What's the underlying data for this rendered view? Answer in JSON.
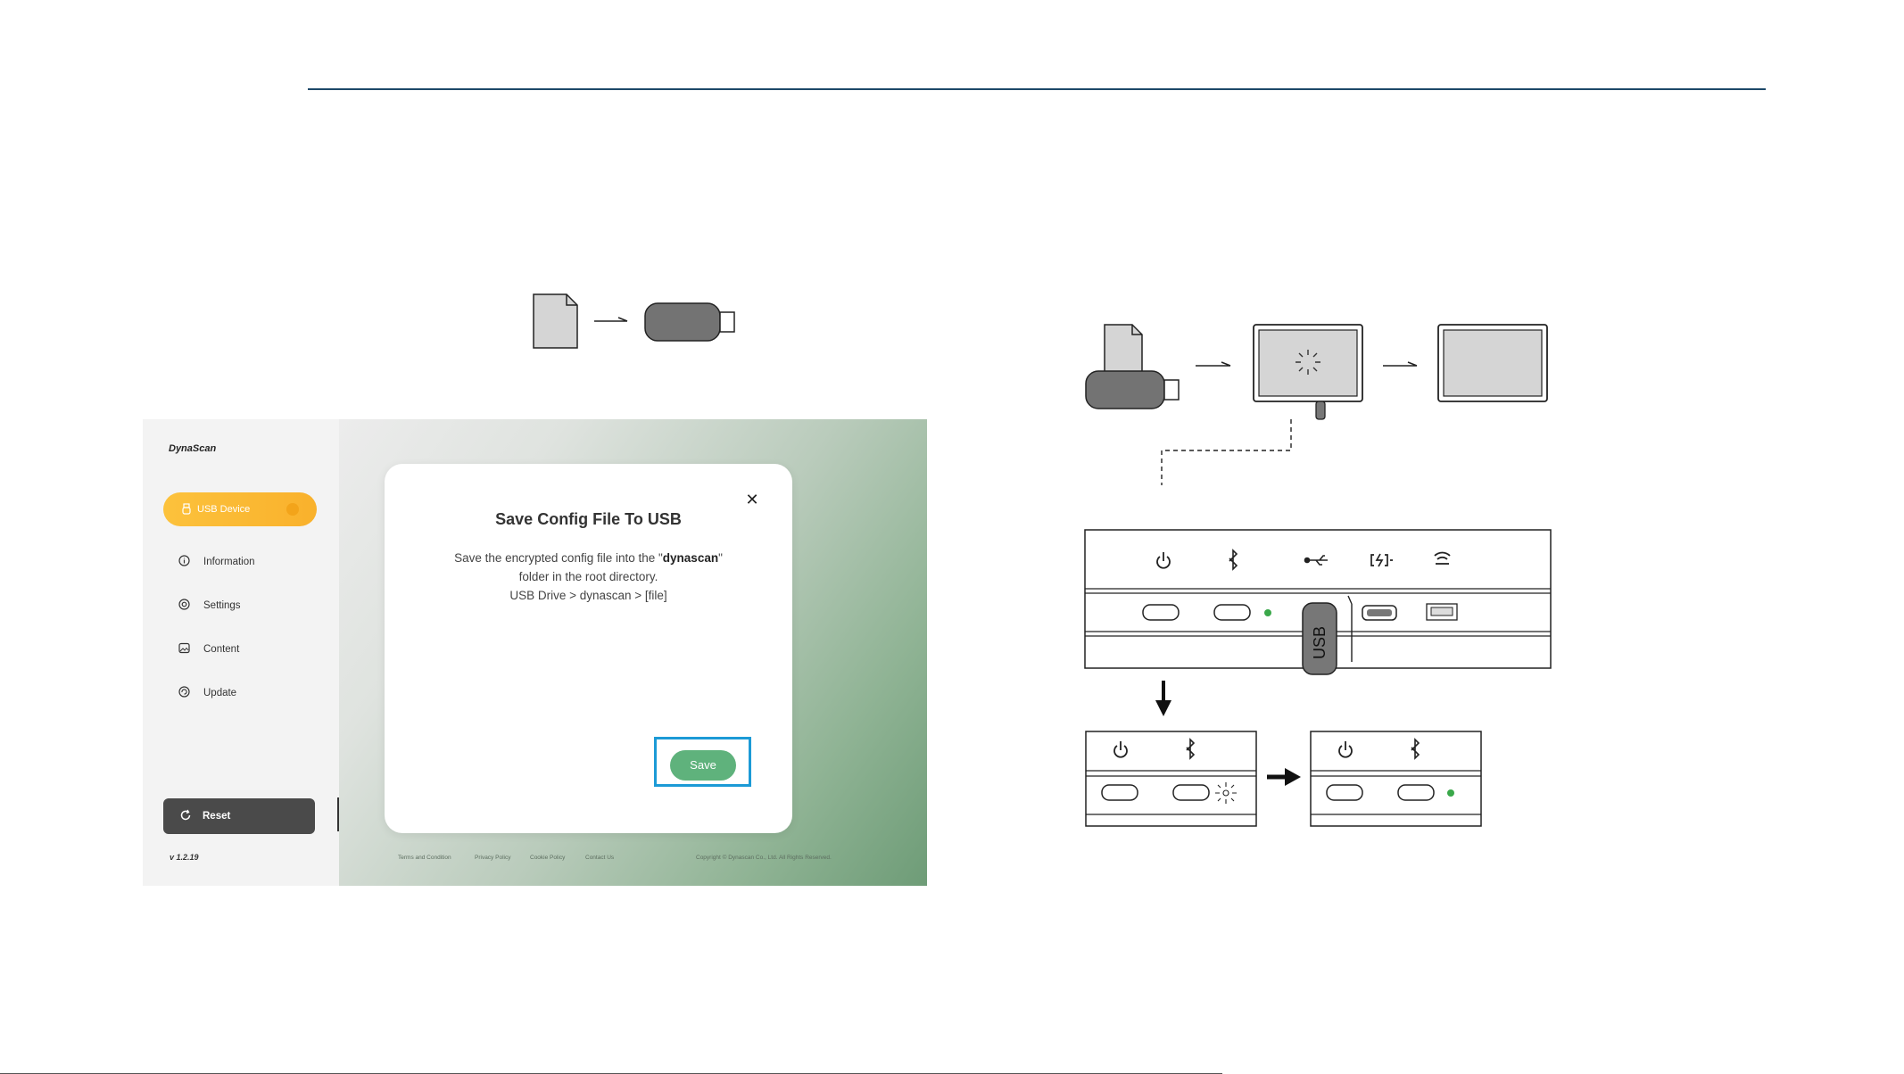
{
  "app": {
    "logo": "DynaScan",
    "nav": {
      "active": {
        "label": "USB Device",
        "icon": "usb-icon"
      },
      "items": [
        {
          "label": "Information",
          "icon": "info-icon"
        },
        {
          "label": "Settings",
          "icon": "gear-icon"
        },
        {
          "label": "Content",
          "icon": "image-icon"
        },
        {
          "label": "Update",
          "icon": "update-icon"
        }
      ]
    },
    "reset_label": "Reset",
    "version": "v 1.2.19",
    "footer": {
      "links": [
        "Terms and Condition",
        "Privacy Policy",
        "Cookie Policy",
        "Contact Us"
      ],
      "copyright": "Copyright © Dynascan Co., Ltd. All Rights Reserved."
    }
  },
  "modal": {
    "title": "Save Config File To USB",
    "body_prefix": "Save the encrypted config file into the \"",
    "body_bold": "dynascan",
    "body_suffix": "\"",
    "body_line2": "folder in the root directory.",
    "body_line3": "USB Drive > dynascan > [file]",
    "close_glyph": "✕",
    "save_label": "Save"
  },
  "diagram": {
    "usb_label": "USB",
    "accent_color": "#5fb27c",
    "highlight_color": "#1c9ad6",
    "indicator_color": "#3aa84a"
  }
}
